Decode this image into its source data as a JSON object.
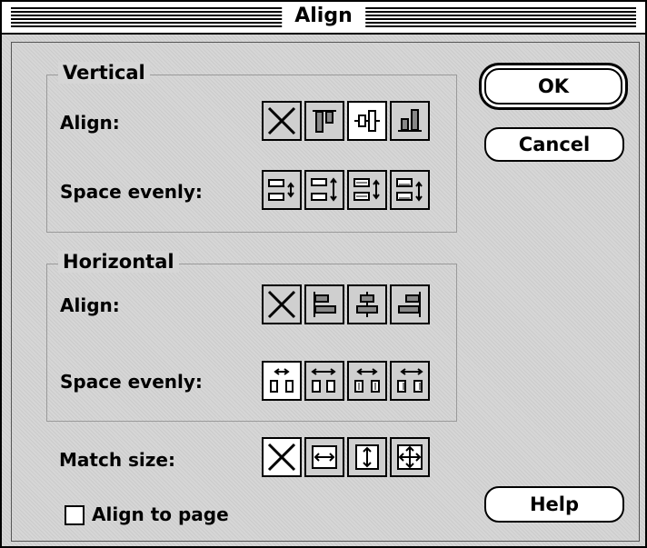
{
  "dialog": {
    "title": "Align"
  },
  "vertical": {
    "group_title": "Vertical",
    "align_label": "Align:",
    "space_label": "Space evenly:",
    "align_icons": [
      "none-icon",
      "align-top-icon",
      "align-middle-icon",
      "align-bottom-icon"
    ],
    "space_icons": [
      "space-vertical-centers-icon",
      "space-vertical-top-icon",
      "space-vertical-center-icon",
      "space-vertical-bottom-icon"
    ],
    "selected_align": "align-middle-icon"
  },
  "horizontal": {
    "group_title": "Horizontal",
    "align_label": "Align:",
    "space_label": "Space evenly:",
    "align_icons": [
      "none-icon",
      "align-left-icon",
      "align-center-icon",
      "align-right-icon"
    ],
    "space_icons": [
      "space-horizontal-centers-icon",
      "space-horizontal-left-icon",
      "space-horizontal-center-icon",
      "space-horizontal-right-icon"
    ],
    "selected_space": "space-horizontal-centers-icon"
  },
  "match_size": {
    "label": "Match size:",
    "icons": [
      "none-icon",
      "match-width-icon",
      "match-height-icon",
      "match-both-icon"
    ],
    "selected": "none-icon"
  },
  "align_to_page": {
    "label": "Align to page",
    "checked": false
  },
  "buttons": {
    "ok": "OK",
    "cancel": "Cancel",
    "help": "Help"
  }
}
